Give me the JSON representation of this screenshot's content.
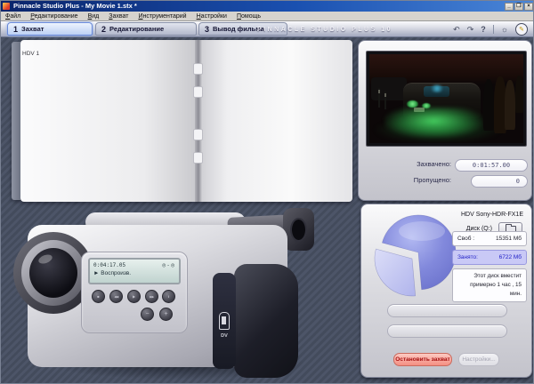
{
  "titlebar": {
    "title": "Pinnacle Studio Plus - My Movie 1.stx *",
    "minimize": "_",
    "maximize": "❐",
    "close": "×"
  },
  "menu": {
    "items": [
      "Файл",
      "Редактирование",
      "Вид",
      "Захват",
      "Инструментарий",
      "Настройки",
      "Помощь"
    ]
  },
  "header": {
    "brand": "PINNACLE STUDIO PLUS 10",
    "tabs": [
      {
        "num": "1",
        "label": "Захват"
      },
      {
        "num": "2",
        "label": "Редактирование"
      },
      {
        "num": "3",
        "label": "Вывод фильма"
      }
    ],
    "icons": {
      "undo": "↶",
      "redo": "↷",
      "help": "?",
      "tip": "☼",
      "premium": "✎"
    }
  },
  "album": {
    "page_label": "HDV 1"
  },
  "preview": {
    "captured_label": "Захвачено:",
    "captured_value": "0:01:57.00",
    "dropped_label": "Пропущено:",
    "dropped_value": "0"
  },
  "camcorder": {
    "lcd_time": "0:04:17.05",
    "lcd_reels": "◎-◎",
    "lcd_status": "► Воспроизв.",
    "buttons": [
      "■",
      "◀◀",
      "▶",
      "▶▶",
      "‖"
    ],
    "minus": "−",
    "plus": "+",
    "dv_label": "DV"
  },
  "diskometer": {
    "device": "HDV Sony-HDR-FX1E",
    "disk_label": "Диск (Q:)",
    "free_label": "Своб :",
    "free_value": "15351 Мб",
    "used_label": "Занято:",
    "used_value": "6722 Мб",
    "capacity_text": "Этот диск вместит примерно 1 час , 15 мин.",
    "stop_button": "Остановить захват",
    "settings_button": "Настройки...",
    "chart": {
      "type": "pie",
      "free_mb": 15351,
      "used_mb": 6722
    }
  },
  "colors": {
    "accent_tab": "#bcd0f4",
    "used_highlight": "#c9c9f6",
    "stop_red": "#a60f0f",
    "pie_main": "#868ee0",
    "pie_slice": "#c9ccf0",
    "neon_green": "#50eb6e"
  }
}
